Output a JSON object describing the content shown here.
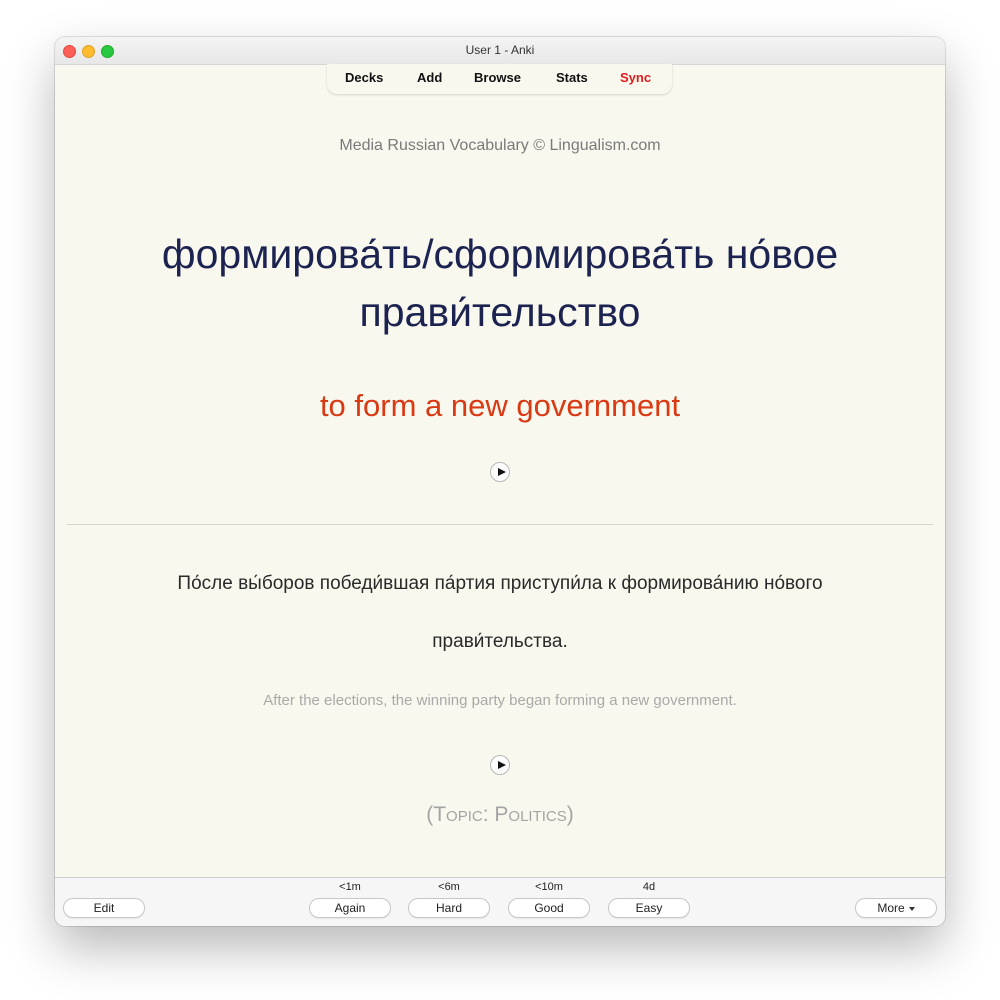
{
  "window": {
    "title": "User 1 - Anki"
  },
  "toolbar": {
    "decks": "Decks",
    "add": "Add",
    "browse": "Browse",
    "stats": "Stats",
    "sync": "Sync",
    "sync_color": "#e31b1b"
  },
  "card": {
    "credit": "Media Russian Vocabulary © Lingualism.com",
    "headword_line1": "формирова́ть/сформирова́ть но́вое",
    "headword_line2": "прави́тельство",
    "translation": "to form a new government",
    "sentence_line1": "По́сле вы́боров победи́вшая па́ртия приступи́ла к формирова́нию но́вого",
    "sentence_line2": "прави́тельства.",
    "sentence_translation": "After the elections, the winning party began forming a new government.",
    "topic": "(Topic: Politics)",
    "audio_icons": [
      "play-icon",
      "play-icon"
    ],
    "headword_color": "#1c2350",
    "translation_color": "#d93a13"
  },
  "answer_bar": {
    "edit": "Edit",
    "more": "More",
    "buttons": [
      {
        "label": "Again",
        "interval": "<1m"
      },
      {
        "label": "Hard",
        "interval": "<6m"
      },
      {
        "label": "Good",
        "interval": "<10m"
      },
      {
        "label": "Easy",
        "interval": "4d"
      }
    ]
  }
}
